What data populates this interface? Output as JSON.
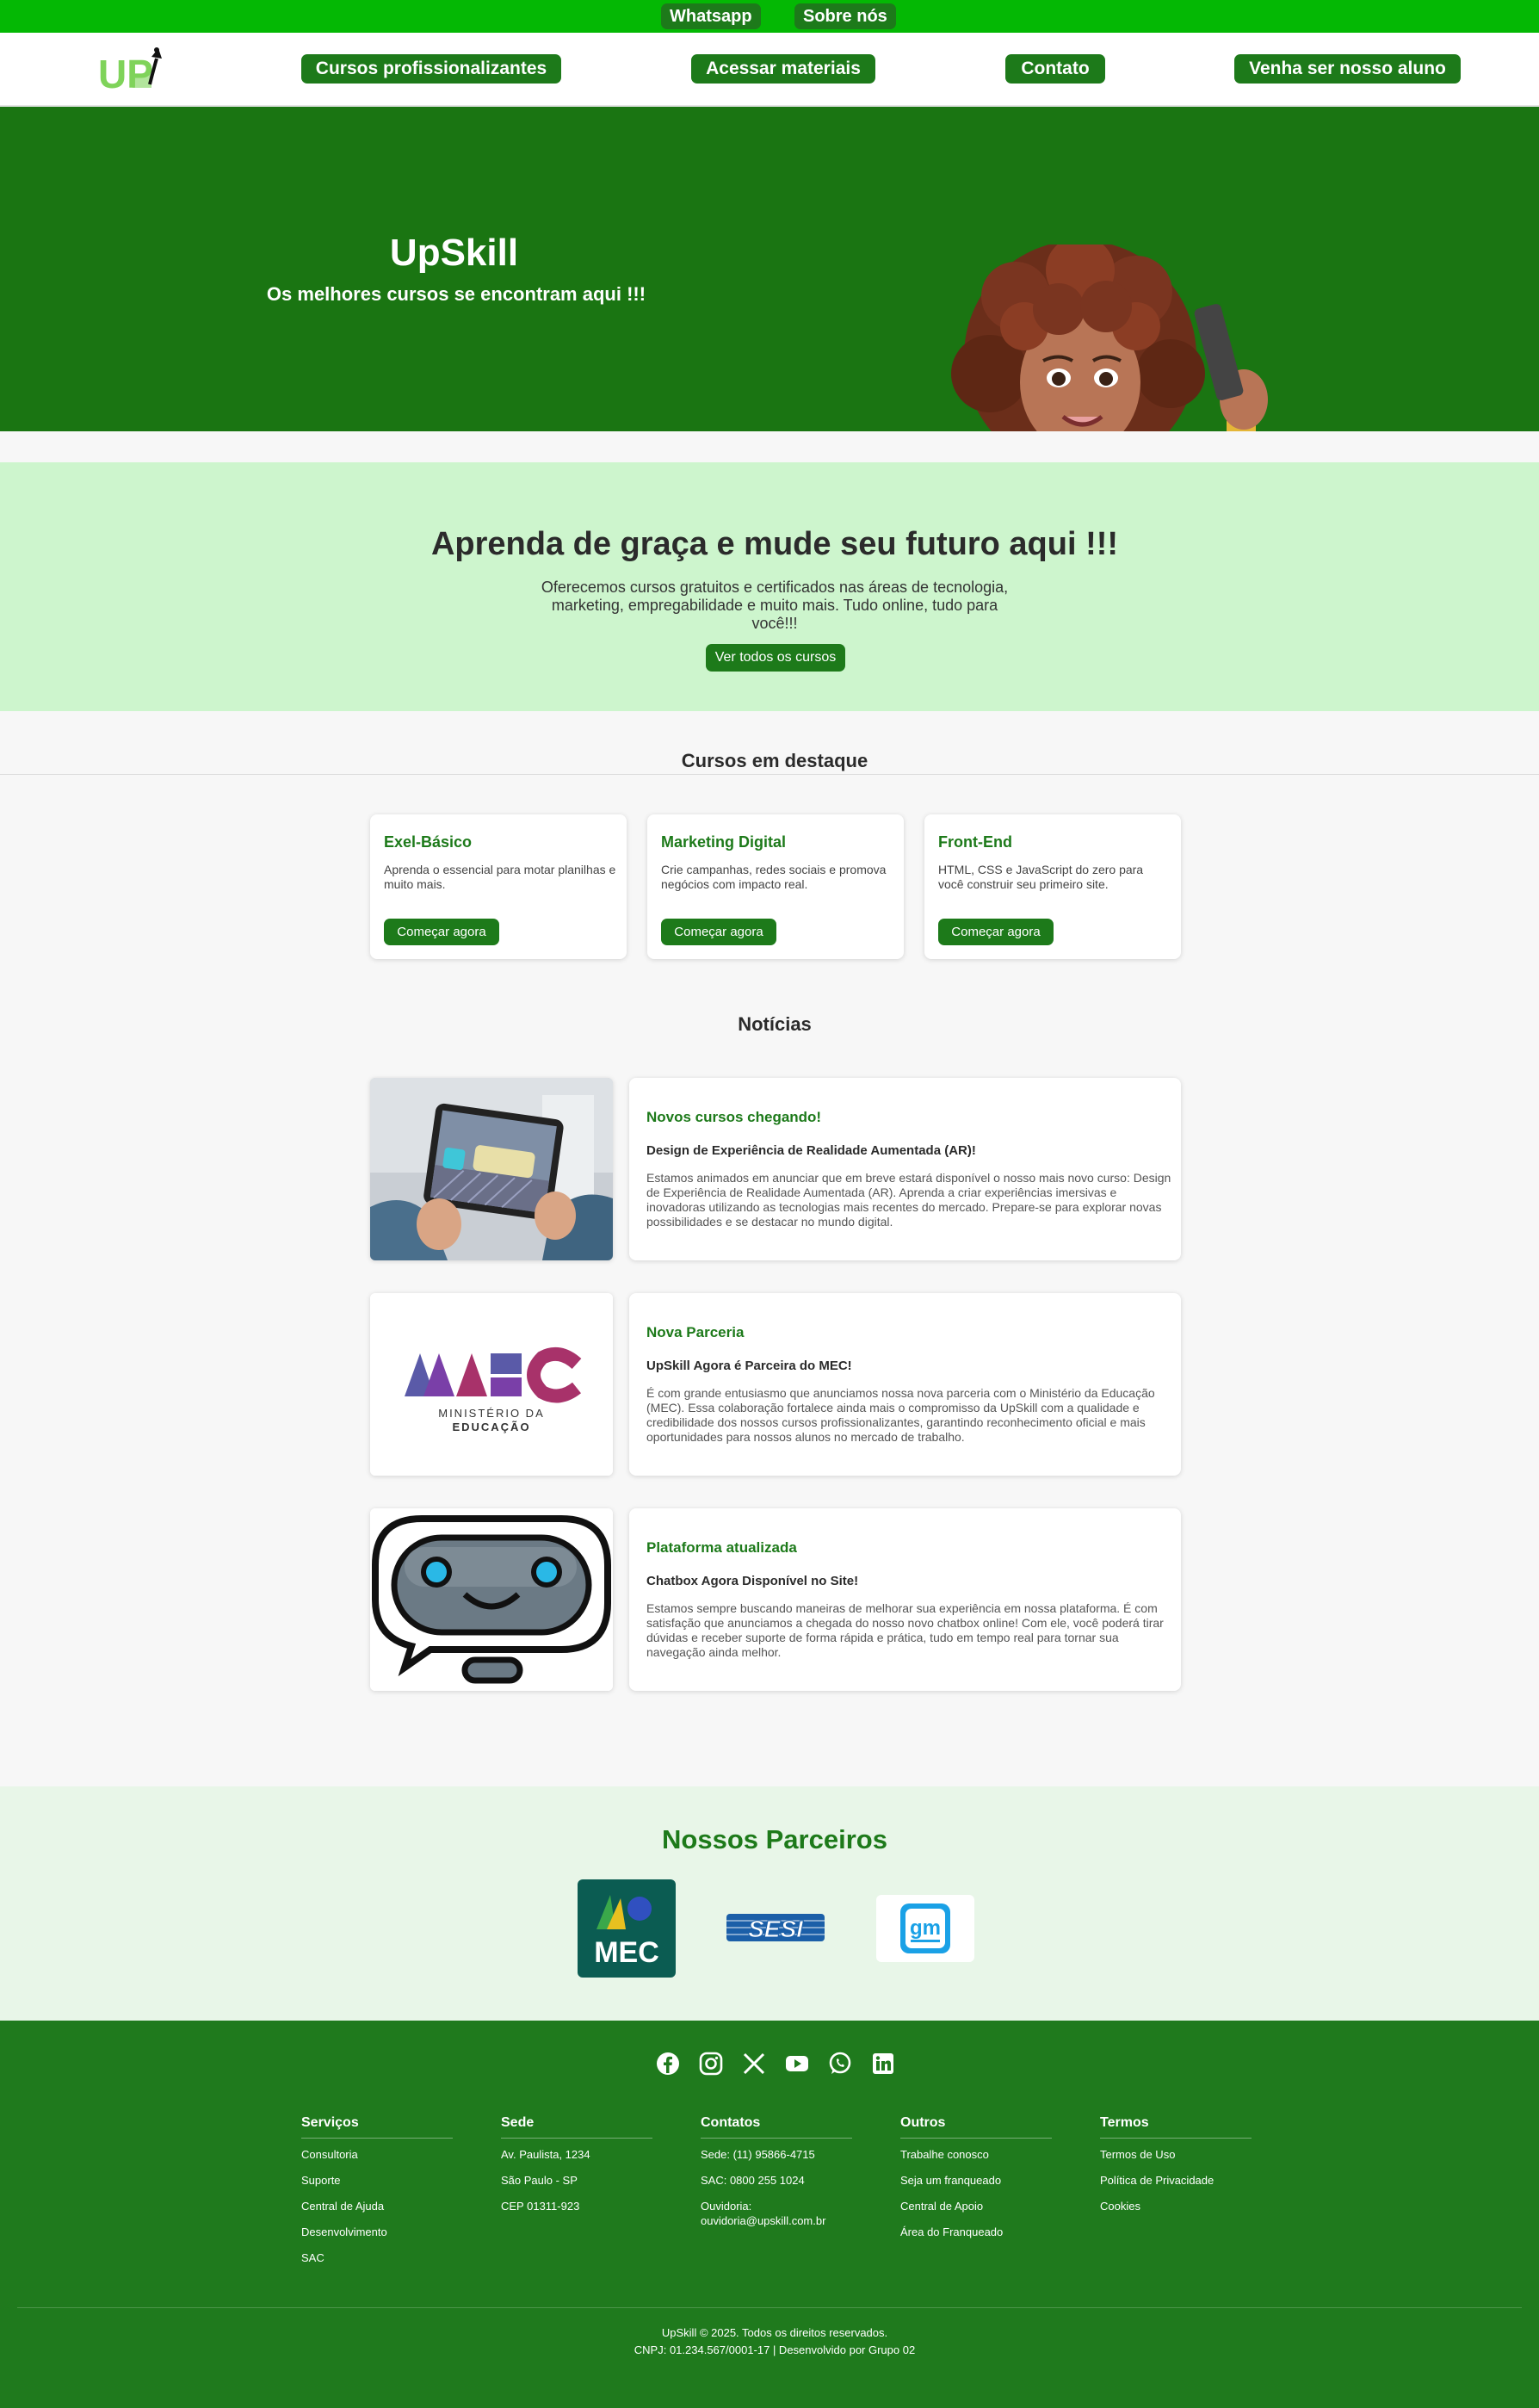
{
  "topbar": {
    "whatsapp": "Whatsapp",
    "about": "Sobre nós"
  },
  "nav": {
    "logo_text": "UP",
    "items": [
      "Cursos profissionalizantes",
      "Acessar materiais",
      "Contato",
      "Venha ser nosso aluno"
    ]
  },
  "hero": {
    "title": "UpSkill",
    "subtitle": "Os melhores cursos se encontram aqui !!!"
  },
  "promo": {
    "title": "Aprenda de graça e mude seu futuro aqui !!!",
    "text": "Oferecemos cursos gratuitos e certificados nas áreas de tecnologia, marketing, empregabilidade e muito mais. Tudo online, tudo para você!!!",
    "button": "Ver todos os cursos"
  },
  "courses": {
    "title": "Cursos em destaque",
    "items": [
      {
        "name": "Exel-Básico",
        "desc": "Aprenda o essencial para motar planilhas e muito mais.",
        "button": "Começar agora"
      },
      {
        "name": "Marketing Digital",
        "desc": "Crie campanhas, redes sociais e promova negócios com impacto real.",
        "button": "Começar agora"
      },
      {
        "name": "Front-End",
        "desc": "HTML, CSS e JavaScript do zero para você construir seu primeiro site.",
        "button": "Começar agora"
      }
    ]
  },
  "news": {
    "title": "Notícias",
    "items": [
      {
        "heading": "Novos cursos chegando!",
        "subheading": "Design de Experiência de Realidade Aumentada (AR)!",
        "text": "Estamos animados em anunciar que em breve estará disponível o nosso mais novo curso: Design de Experiência de Realidade Aumentada (AR). Aprenda a criar experiências imersivas e inovadoras utilizando as tecnologias mais recentes do mercado. Prepare-se para explorar novas possibilidades e se destacar no mundo digital."
      },
      {
        "heading": "Nova Parceria",
        "subheading": "UpSkill Agora é Parceira do MEC!",
        "text": "É com grande entusiasmo que anunciamos nossa nova parceria com o Ministério da Educação (MEC). Essa colaboração fortalece ainda mais o compromisso da UpSkill com a qualidade e credibilidade dos nossos cursos profissionalizantes, garantindo reconhecimento oficial e mais oportunidades para nossos alunos no mercado de trabalho.",
        "image_text": {
          "logo": "MEC",
          "line1": "MINISTÉRIO DA",
          "line2": "EDUCAÇÃO"
        }
      },
      {
        "heading": "Plataforma atualizada",
        "subheading": "Chatbox Agora Disponível no Site!",
        "text": "Estamos sempre buscando maneiras de melhorar sua experiência em nossa plataforma. É com satisfação que anunciamos a chegada do nosso novo chatbox online! Com ele, você poderá tirar dúvidas e receber suporte de forma rápida e prática, tudo em tempo real para tornar sua navegação ainda melhor."
      }
    ]
  },
  "partners": {
    "title": "Nossos Parceiros",
    "logos": [
      "MEC",
      "SESI",
      "gm"
    ]
  },
  "footer": {
    "social_icons": [
      "facebook-icon",
      "instagram-icon",
      "x-icon",
      "youtube-icon",
      "whatsapp-icon",
      "linkedin-icon"
    ],
    "columns": [
      {
        "title": "Serviços",
        "items": [
          "Consultoria",
          "Suporte",
          "Central de Ajuda",
          "Desenvolvimento",
          "SAC"
        ]
      },
      {
        "title": "Sede",
        "items": [
          "Av. Paulista, 1234",
          "São Paulo - SP",
          "CEP 01311-923"
        ]
      },
      {
        "title": "Contatos",
        "items": [
          "Sede: (11) 95866-4715",
          "SAC: 0800 255 1024",
          "Ouvidoria: ouvidoria@upskill.com.br"
        ]
      },
      {
        "title": "Outros",
        "items": [
          "Trabalhe conosco",
          "Seja um franqueado",
          "Central de Apoio",
          "Área do Franqueado"
        ]
      },
      {
        "title": "Termos",
        "items": [
          "Termos de Uso",
          "Política de Privacidade",
          "Cookies"
        ]
      }
    ],
    "copyright": "UpSkill © 2025. Todos os direitos reservados.",
    "cnpj": "CNPJ: 01.234.567/0001-17 | Desenvolvido por Grupo 02"
  },
  "colors": {
    "brand_green": "#1d7a1a",
    "top_green": "#04b804",
    "promo_bg": "#cdf5cd",
    "partners_bg": "#e8f6e8"
  }
}
